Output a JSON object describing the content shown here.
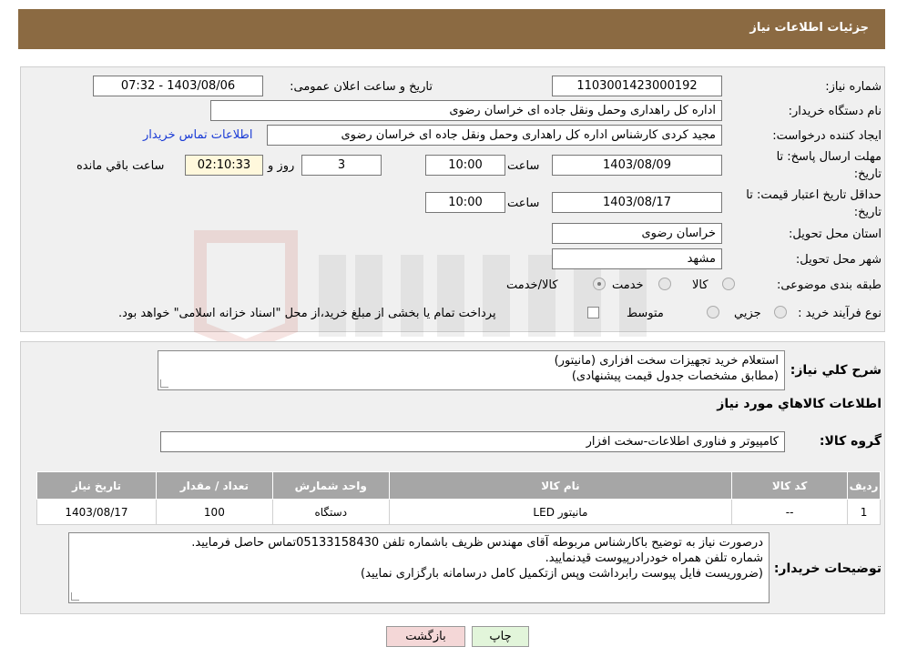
{
  "header": {
    "title": "جزئیات اطلاعات نیاز"
  },
  "fields": {
    "need_number_label": "شماره نیاز:",
    "need_number": "1103001423000192",
    "announce_label": "تاریخ و ساعت اعلان عمومی:",
    "announce_value": "1403/08/06 - 07:32",
    "buyer_org_label": "نام دستگاه خریدار:",
    "buyer_org": "اداره کل راهداری وحمل ونقل جاده ای خراسان رضوی",
    "creator_label": "ایجاد کننده درخواست:",
    "creator": "مجید کردی کارشناس اداره کل راهداری وحمل ونقل جاده ای خراسان رضوی",
    "contact_link": "اطلاعات تماس خریدار",
    "deadline_label_1": "مهلت ارسال پاسخ: تا",
    "deadline_label_2": "تاریخ:",
    "deadline_date": "1403/08/09",
    "time_label": "ساعت",
    "deadline_time": "10:00",
    "days_value": "3",
    "days_label": "روز و",
    "remaining_time": "02:10:33",
    "remaining_label": "ساعت باقي مانده",
    "validity_label_1": "حداقل تاریخ اعتبار قیمت: تا",
    "validity_label_2": "تاریخ:",
    "validity_date": "1403/08/17",
    "validity_time": "10:00",
    "province_label": "استان محل تحویل:",
    "province": "خراسان رضوی",
    "city_label": "شهر محل تحویل:",
    "city": "مشهد",
    "category_label": "طبقه بندی موضوعی:",
    "category_options": [
      "کالا",
      "خدمت",
      "کالا/خدمت"
    ],
    "process_label": "نوع فرآیند خرید :",
    "process_options": [
      "جزيي",
      "متوسط"
    ],
    "payment_note": "پرداخت تمام یا بخشی از مبلغ خرید،از محل \"اسناد خزانه اسلامی\" خواهد بود."
  },
  "description": {
    "label": "شرح کلي نياز:",
    "line1": "استعلام خرید تجهیزات سخت افزاری  (مانیتور)",
    "line2": "(مطابق مشخصات جدول قیمت پیشنهادی)"
  },
  "goods": {
    "section_title": "اطلاعات کالاهاي مورد نياز",
    "group_label": "گروه کالا:",
    "group_value": "کامپیوتر و فناوری اطلاعات-سخت افزار",
    "columns": [
      "رديف",
      "کد کالا",
      "نام کالا",
      "واحد شمارش",
      "تعداد / مقدار",
      "تاريخ نياز"
    ],
    "rows": [
      [
        "1",
        "--",
        "مانیتور LED",
        "دستگاه",
        "100",
        "1403/08/17"
      ]
    ]
  },
  "buyer_notes": {
    "label": "توضيحات خريدار:",
    "line1": "درصورت نیاز به توضیح باکارشناس مربوطه آقای مهندس ظریف باشماره تلفن 05133158430تماس حاصل فرمایید.",
    "line2": "شماره تلفن همراه خودرادرپیوست قیدنمایید.",
    "line3": "(ضروریست فایل پیوست رابرداشت وپس ازتکمیل کامل درسامانه بارگزاری نمایید)"
  },
  "buttons": {
    "print": "چاپ",
    "back": "بازگشت"
  },
  "colors": {
    "header_bg": "#8b6a42",
    "back_button_bg": "#f4d7d7",
    "print_button_bg": "#e2f5da"
  }
}
